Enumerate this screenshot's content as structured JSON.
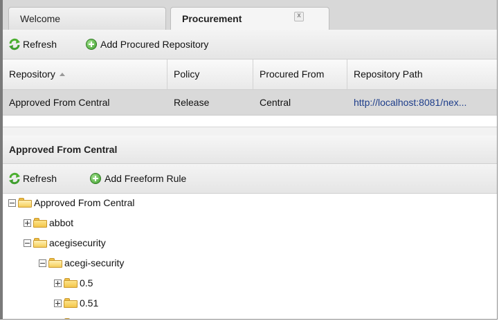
{
  "tabs": [
    {
      "label": "Welcome",
      "active": false
    },
    {
      "label": "Procurement",
      "active": true,
      "close_glyph": "x"
    }
  ],
  "toolbar_top": {
    "refresh_label": "Refresh",
    "add_label": "Add Procured Repository"
  },
  "grid": {
    "columns": [
      "Repository",
      "Policy",
      "Procured From",
      "Repository Path"
    ],
    "rows": [
      {
        "repository": "Approved From Central",
        "policy": "Release",
        "procured_from": "Central",
        "path": "http://localhost:8081/nex..."
      }
    ]
  },
  "detail_panel": {
    "title": "Approved From Central"
  },
  "toolbar_bottom": {
    "refresh_label": "Refresh",
    "add_label": "Add Freeform Rule"
  },
  "tree": {
    "root": "Approved From Central",
    "nodes": [
      {
        "label": "abbot",
        "expanded": false
      },
      {
        "label": "acegisecurity",
        "expanded": true
      },
      {
        "label": "acegi-security",
        "expanded": true
      },
      {
        "label": "0.5",
        "expanded": false
      },
      {
        "label": "0.51",
        "expanded": false
      }
    ]
  },
  "colors": {
    "folder": "#f4c64a",
    "add_icon": "#3f9e2e",
    "refresh_icon": "#4caf30",
    "selected_row": "#d9d9d9",
    "link": "#1d3d8a"
  }
}
